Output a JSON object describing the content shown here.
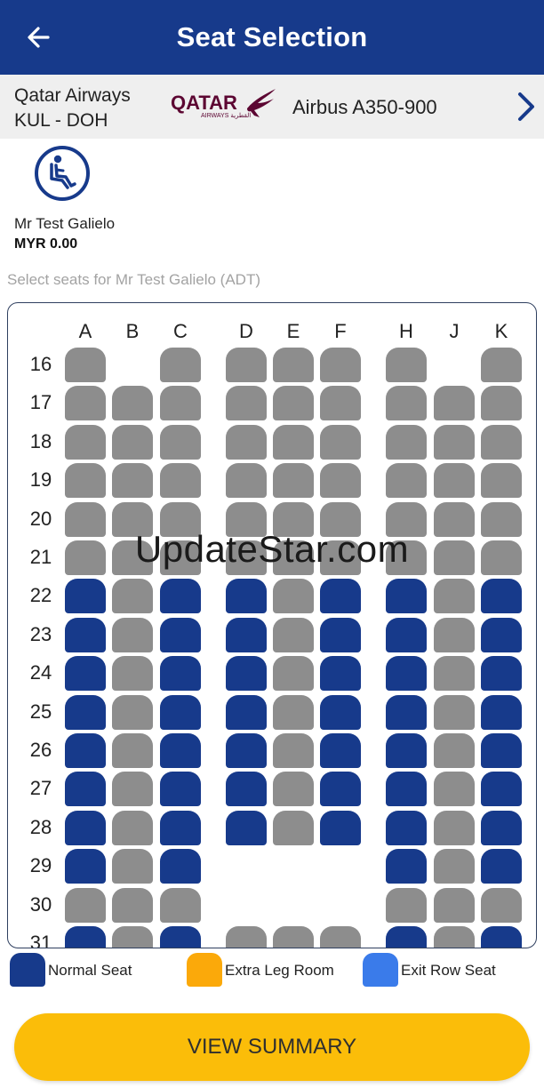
{
  "header": {
    "title": "Seat Selection",
    "back_icon": "arrow-left-icon"
  },
  "flight": {
    "airline": "Qatar Airways",
    "route": "KUL - DOH",
    "logo": {
      "word": "QATAR",
      "sub": "AIRWAYS القطرية",
      "color": "#5c0632"
    },
    "aircraft": "Airbus A350-900",
    "chevron_icon": "chevron-right-icon"
  },
  "passenger": {
    "icon": "seated-passenger-icon",
    "name": "Mr Test Galielo",
    "price": "MYR 0.00"
  },
  "select_hint": "Select seats for Mr Test Galielo (ADT)",
  "seatmap": {
    "columns": [
      "A",
      "B",
      "C",
      "D",
      "E",
      "F",
      "H",
      "J",
      "K"
    ],
    "rows": [
      {
        "number": "16",
        "seats": [
          "o",
          "-",
          "o",
          "o",
          "o",
          "o",
          "o",
          "-",
          "o"
        ]
      },
      {
        "number": "17",
        "seats": [
          "o",
          "o",
          "o",
          "o",
          "o",
          "o",
          "o",
          "o",
          "o"
        ]
      },
      {
        "number": "18",
        "seats": [
          "o",
          "o",
          "o",
          "o",
          "o",
          "o",
          "o",
          "o",
          "o"
        ]
      },
      {
        "number": "19",
        "seats": [
          "o",
          "o",
          "o",
          "o",
          "o",
          "o",
          "o",
          "o",
          "o"
        ]
      },
      {
        "number": "20",
        "seats": [
          "o",
          "o",
          "o",
          "o",
          "o",
          "o",
          "o",
          "o",
          "o"
        ]
      },
      {
        "number": "21",
        "seats": [
          "o",
          "o",
          "o",
          "o",
          "o",
          "o",
          "o",
          "o",
          "o"
        ]
      },
      {
        "number": "22",
        "seats": [
          "a",
          "o",
          "a",
          "a",
          "o",
          "a",
          "a",
          "o",
          "a"
        ]
      },
      {
        "number": "23",
        "seats": [
          "a",
          "o",
          "a",
          "a",
          "o",
          "a",
          "a",
          "o",
          "a"
        ]
      },
      {
        "number": "24",
        "seats": [
          "a",
          "o",
          "a",
          "a",
          "o",
          "a",
          "a",
          "o",
          "a"
        ]
      },
      {
        "number": "25",
        "seats": [
          "a",
          "o",
          "a",
          "a",
          "o",
          "a",
          "a",
          "o",
          "a"
        ]
      },
      {
        "number": "26",
        "seats": [
          "a",
          "o",
          "a",
          "a",
          "o",
          "a",
          "a",
          "o",
          "a"
        ]
      },
      {
        "number": "27",
        "seats": [
          "a",
          "o",
          "a",
          "a",
          "o",
          "a",
          "a",
          "o",
          "a"
        ]
      },
      {
        "number": "28",
        "seats": [
          "a",
          "o",
          "a",
          "a",
          "o",
          "a",
          "a",
          "o",
          "a"
        ]
      },
      {
        "number": "29",
        "seats": [
          "a",
          "o",
          "a",
          "-",
          "-",
          "-",
          "a",
          "o",
          "a"
        ]
      },
      {
        "number": "30",
        "seats": [
          "o",
          "o",
          "o",
          "-",
          "-",
          "-",
          "o",
          "o",
          "o"
        ]
      },
      {
        "number": "31",
        "seats": [
          "a",
          "o",
          "a",
          "o",
          "o",
          "o",
          "a",
          "o",
          "a"
        ]
      }
    ],
    "status_colors": {
      "available": "#173a8b",
      "occupied": "#8d8d8d"
    }
  },
  "legend": [
    {
      "label": "Normal Seat",
      "color": "#173a8b"
    },
    {
      "label": "Extra Leg Room",
      "color": "#fba90a"
    },
    {
      "label": "Exit Row Seat",
      "color": "#3a7bea"
    }
  ],
  "summary_button": "VIEW SUMMARY",
  "watermark": "UpdateStar.com"
}
